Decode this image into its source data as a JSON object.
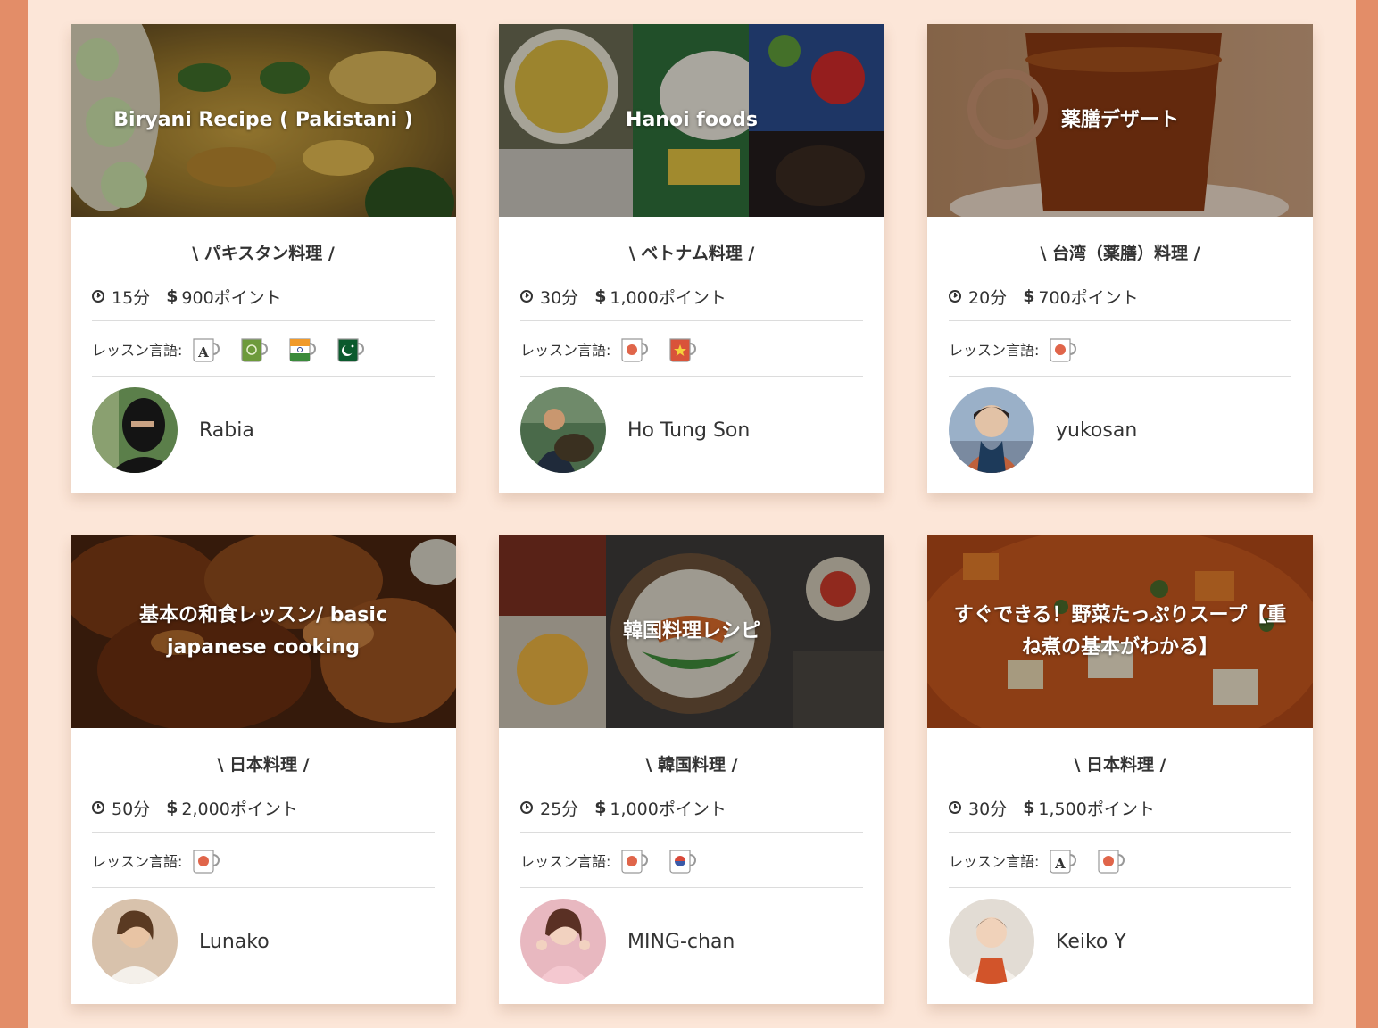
{
  "lang_label": "レッスン言語:",
  "cards": [
    {
      "title": "Biryani Recipe ( Pakistani )",
      "cuisine": "\\ パキスタン料理 /",
      "duration": "15分",
      "dollar": "$",
      "price": "900ポイント",
      "teacher": "Rabia",
      "langs": [
        "english-mug-icon",
        "urdu-mug-icon",
        "hindi-mug-icon",
        "pakistan-mug-icon"
      ]
    },
    {
      "title": "Hanoi foods",
      "cuisine": "\\ ベトナム料理 /",
      "duration": "30分",
      "dollar": "$",
      "price": "1,000ポイント",
      "teacher": "Ho Tung Son",
      "langs": [
        "japanese-mug-icon",
        "vietnamese-mug-icon"
      ]
    },
    {
      "title": "薬膳デザート",
      "cuisine": "\\ 台湾（薬膳）料理 /",
      "duration": "20分",
      "dollar": "$",
      "price": "700ポイント",
      "teacher": "yukosan",
      "langs": [
        "japanese-mug-icon"
      ]
    },
    {
      "title": "基本の和食レッスン/ basic japanese cooking",
      "cuisine": "\\ 日本料理 /",
      "duration": "50分",
      "dollar": "$",
      "price": "2,000ポイント",
      "teacher": "Lunako",
      "langs": [
        "japanese-mug-icon"
      ]
    },
    {
      "title": "韓国料理レシピ",
      "cuisine": "\\ 韓国料理 /",
      "duration": "25分",
      "dollar": "$",
      "price": "1,000ポイント",
      "teacher": "MING-chan",
      "langs": [
        "japanese-mug-icon",
        "korean-mug-icon"
      ]
    },
    {
      "title": "すぐできる！野菜たっぷりスープ【重ね煮の基本がわかる】",
      "cuisine": "\\ 日本料理 /",
      "duration": "30分",
      "dollar": "$",
      "price": "1,500ポイント",
      "teacher": "Keiko Y",
      "langs": [
        "english-mug-icon",
        "japanese-mug-icon"
      ]
    }
  ],
  "colors": {
    "page_bg": "#fce6d8",
    "frame": "#e38d68",
    "text": "#333333"
  }
}
